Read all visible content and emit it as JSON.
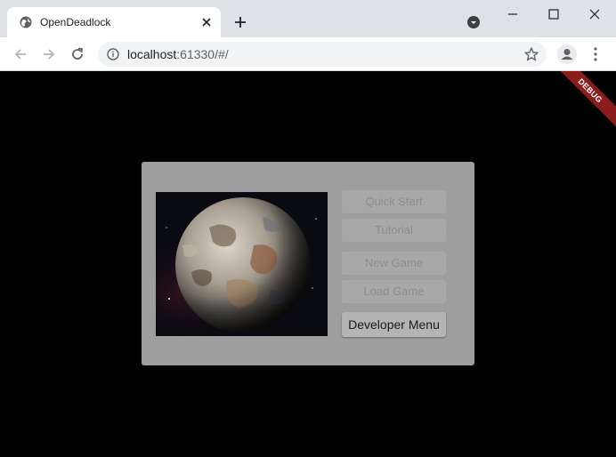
{
  "browser": {
    "tab_title": "OpenDeadlock",
    "url_host": "localhost",
    "url_rest": ":61330/#/"
  },
  "app": {
    "debug_label": "DEBUG",
    "menu": {
      "quick_start": "Quick Start",
      "tutorial": "Tutorial",
      "new_game": "New Game",
      "load_game": "Load Game",
      "developer_menu": "Developer Menu"
    },
    "image": "planet"
  },
  "colors": {
    "panel": "#9e9e9e",
    "debug_banner": "#8a1c1c",
    "disabled_text": "#8c8c8c"
  }
}
